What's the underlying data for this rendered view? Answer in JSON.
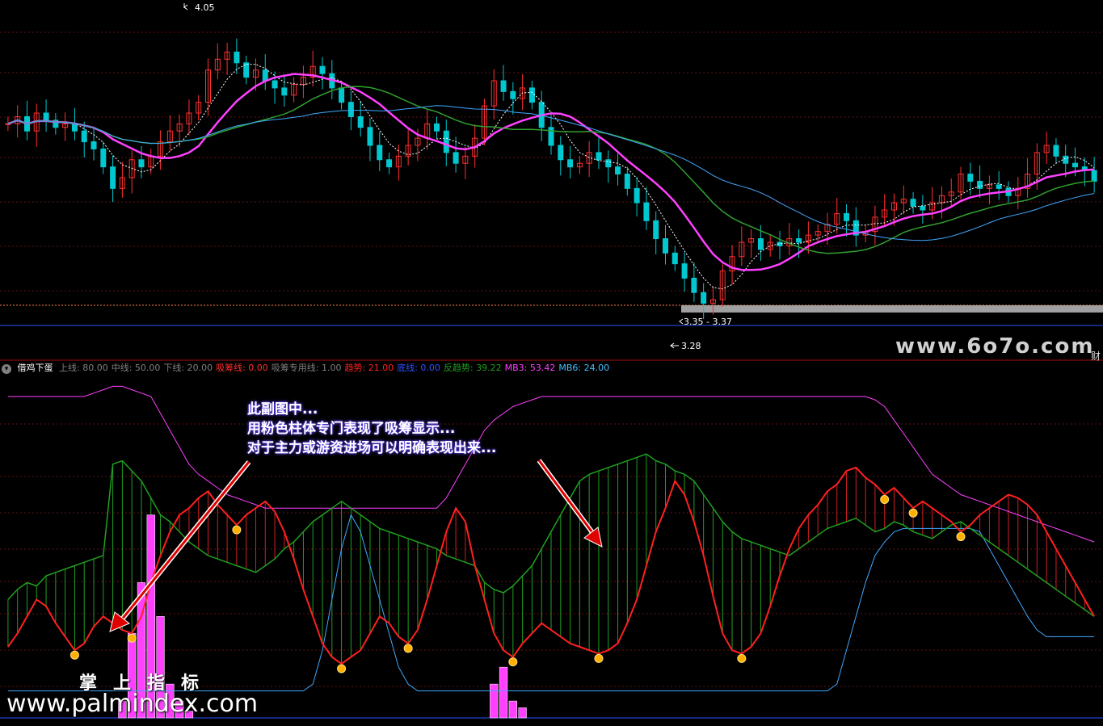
{
  "price_panel": {
    "high_label": "4.05",
    "low_label": "3.28",
    "range_label": "3.35 - 3.37",
    "side_tab": "财",
    "watermark": "www.6o7o.com"
  },
  "indicator_header": {
    "collapse_icon": "chevron-down-icon",
    "name": "借鸡下蛋",
    "items": [
      {
        "label": "上线:",
        "value": "80.00",
        "color": "#808080"
      },
      {
        "label": "中线:",
        "value": "50.00",
        "color": "#808080"
      },
      {
        "label": "下线:",
        "value": "20.00",
        "color": "#808080"
      },
      {
        "label": "吸筹线:",
        "value": "0.00",
        "color": "#ff3030"
      },
      {
        "label": "吸筹专用线:",
        "value": "1.00",
        "color": "#808080"
      },
      {
        "label": "趋势:",
        "value": "21.00",
        "color": "#ff2020"
      },
      {
        "label": "底线:",
        "value": "0.00",
        "color": "#3050ff"
      },
      {
        "label": "反趋势:",
        "value": "39.22",
        "color": "#20a020"
      },
      {
        "label": "MB3:",
        "value": "53.42",
        "color": "#ff40ff"
      },
      {
        "label": "MB6:",
        "value": "24.00",
        "color": "#40c0ff"
      }
    ]
  },
  "annotation": {
    "line1": "此副图中...",
    "line2": "用粉色柱体专门表现了吸筹显示...",
    "line3": "对于主力或游资进场可以明确表现出来..."
  },
  "watermarks": {
    "brand_cn": "掌上指标",
    "brand_url": "www.palmindex.com"
  },
  "colors": {
    "up": "#ff3030",
    "down": "#00c8d0",
    "ma_short": "#ff40ff",
    "ma_mid": "#30a030",
    "ma_long": "#40a8ff",
    "absorb_bar": "#ff40ff",
    "trend": "#ff2020",
    "counter_trend": "#20a020",
    "mb3": "#ff40ff",
    "mb6": "#40a8ff",
    "bottom": "#3050ff"
  },
  "chart_data": [
    {
      "type": "candlestick",
      "title": "",
      "annotations": [
        "4.05",
        "3.28",
        "3.35 - 3.37"
      ],
      "ylim": [
        3.2,
        4.1
      ],
      "closes": [
        3.8,
        3.82,
        3.78,
        3.83,
        3.81,
        3.79,
        3.8,
        3.78,
        3.75,
        3.73,
        3.68,
        3.62,
        3.65,
        3.7,
        3.68,
        3.71,
        3.75,
        3.78,
        3.8,
        3.83,
        3.86,
        3.95,
        3.98,
        4.0,
        3.97,
        3.93,
        3.95,
        3.92,
        3.9,
        3.88,
        3.91,
        3.93,
        3.96,
        3.94,
        3.9,
        3.86,
        3.82,
        3.79,
        3.74,
        3.7,
        3.68,
        3.71,
        3.74,
        3.76,
        3.8,
        3.78,
        3.72,
        3.69,
        3.71,
        3.76,
        3.85,
        3.92,
        3.89,
        3.87,
        3.9,
        3.86,
        3.79,
        3.74,
        3.7,
        3.68,
        3.69,
        3.72,
        3.7,
        3.68,
        3.66,
        3.62,
        3.58,
        3.53,
        3.48,
        3.44,
        3.41,
        3.37,
        3.33,
        3.3,
        3.31,
        3.39,
        3.43,
        3.47,
        3.48,
        3.45,
        3.47,
        3.46,
        3.48,
        3.47,
        3.49,
        3.5,
        3.52,
        3.55,
        3.53,
        3.49,
        3.5,
        3.54,
        3.56,
        3.58,
        3.59,
        3.57,
        3.56,
        3.58,
        3.6,
        3.61,
        3.66,
        3.64,
        3.62,
        3.63,
        3.62,
        3.6,
        3.62,
        3.66,
        3.72,
        3.74,
        3.71,
        3.69,
        3.68,
        3.67,
        3.64
      ]
    },
    {
      "type": "mixed",
      "title": "借鸡下蛋",
      "ylim": [
        0,
        100
      ],
      "series": [
        {
          "name": "吸筹线",
          "kind": "bar",
          "values": [
            0,
            0,
            0,
            0,
            0,
            0,
            0,
            0,
            0,
            0,
            0,
            0,
            5,
            25,
            40,
            60,
            30,
            10,
            5,
            2,
            0,
            0,
            0,
            0,
            0,
            0,
            0,
            0,
            0,
            0,
            0,
            0,
            0,
            0,
            0,
            0,
            0,
            0,
            0,
            0,
            0,
            0,
            0,
            0,
            0,
            0,
            0,
            0,
            0,
            0,
            0,
            10,
            15,
            5,
            3,
            0,
            0,
            0,
            0,
            0,
            0,
            0,
            0,
            0,
            0,
            0,
            0,
            0,
            0,
            0,
            0,
            0,
            0,
            0,
            0,
            0,
            0,
            0,
            0,
            0,
            0,
            0,
            0,
            0,
            0,
            0,
            0,
            0,
            0,
            0,
            0,
            0,
            0,
            0,
            0,
            0,
            0,
            0,
            0,
            0,
            0,
            0,
            0,
            0,
            0,
            0,
            0,
            0,
            0,
            0,
            0,
            0,
            0,
            0,
            0
          ]
        },
        {
          "name": "趋势",
          "kind": "line",
          "values": [
            21,
            25,
            30,
            35,
            33,
            28,
            24,
            20,
            22,
            27,
            30,
            28,
            26,
            25,
            30,
            40,
            48,
            55,
            60,
            62,
            65,
            67,
            63,
            60,
            57,
            60,
            62,
            64,
            61,
            55,
            47,
            38,
            30,
            22,
            18,
            16,
            18,
            20,
            25,
            30,
            28,
            24,
            22,
            26,
            35,
            45,
            55,
            62,
            58,
            45,
            35,
            25,
            20,
            18,
            22,
            25,
            28,
            26,
            24,
            22,
            21,
            20,
            19,
            20,
            22,
            28,
            35,
            45,
            55,
            62,
            70,
            66,
            58,
            48,
            36,
            25,
            20,
            19,
            21,
            25,
            33,
            42,
            50,
            56,
            60,
            63,
            67,
            69,
            73,
            74,
            71,
            69,
            66,
            68,
            65,
            62,
            64,
            62,
            60,
            58,
            55,
            57,
            60,
            62,
            64,
            66,
            65,
            63,
            60,
            55,
            50,
            45,
            40,
            35,
            30
          ]
        },
        {
          "name": "反趋势",
          "kind": "line",
          "values": [
            35,
            38,
            40,
            39,
            42,
            43,
            44,
            45,
            46,
            47,
            48,
            75,
            76,
            73,
            70,
            65,
            60,
            58,
            55,
            52,
            50,
            48,
            47,
            46,
            45,
            44,
            43,
            45,
            47,
            50,
            52,
            55,
            58,
            60,
            62,
            64,
            62,
            60,
            58,
            56,
            55,
            54,
            53,
            52,
            51,
            50,
            48,
            47,
            46,
            45,
            40,
            38,
            37,
            39,
            42,
            45,
            50,
            55,
            60,
            65,
            70,
            72,
            73,
            74,
            75,
            76,
            77,
            78,
            76,
            75,
            73,
            72,
            70,
            66,
            62,
            58,
            55,
            53,
            52,
            51,
            50,
            49,
            48,
            50,
            52,
            54,
            56,
            57,
            58,
            59,
            57,
            55,
            56,
            58,
            57,
            55,
            54,
            53,
            55,
            57,
            58,
            56,
            54,
            52,
            50,
            48,
            46,
            44,
            42,
            40,
            38,
            36,
            34,
            32,
            30
          ]
        },
        {
          "name": "MB3",
          "kind": "line",
          "values": [
            95,
            95,
            95,
            95,
            95,
            95,
            95,
            95,
            95,
            96,
            97,
            98,
            98,
            97,
            96,
            95,
            90,
            85,
            80,
            75,
            72,
            70,
            68,
            66,
            65,
            64,
            63,
            62,
            62,
            62,
            62,
            62,
            62,
            62,
            62,
            62,
            62,
            62,
            62,
            62,
            62,
            62,
            62,
            62,
            62,
            62,
            65,
            70,
            75,
            80,
            85,
            88,
            90,
            92,
            93,
            94,
            95,
            95,
            95,
            95,
            95,
            95,
            95,
            95,
            95,
            95,
            95,
            95,
            95,
            95,
            95,
            95,
            95,
            95,
            95,
            95,
            95,
            95,
            95,
            95,
            95,
            95,
            95,
            95,
            95,
            95,
            95,
            95,
            95,
            95,
            95,
            94,
            92,
            88,
            84,
            80,
            76,
            72,
            70,
            68,
            66,
            65,
            64,
            63,
            62,
            61,
            60,
            59,
            58,
            57,
            56,
            55,
            54,
            53,
            52
          ]
        },
        {
          "name": "MB6",
          "kind": "line",
          "values": [
            8,
            8,
            8,
            8,
            8,
            8,
            8,
            8,
            8,
            8,
            8,
            8,
            8,
            8,
            8,
            8,
            8,
            8,
            8,
            8,
            8,
            8,
            8,
            8,
            8,
            8,
            8,
            8,
            8,
            8,
            8,
            8,
            10,
            20,
            35,
            50,
            60,
            55,
            45,
            35,
            25,
            15,
            10,
            8,
            8,
            8,
            8,
            8,
            8,
            8,
            8,
            8,
            8,
            8,
            8,
            8,
            8,
            8,
            8,
            8,
            8,
            8,
            8,
            8,
            8,
            8,
            8,
            8,
            8,
            8,
            8,
            8,
            8,
            8,
            8,
            8,
            8,
            8,
            8,
            8,
            8,
            8,
            8,
            8,
            8,
            8,
            8,
            10,
            20,
            30,
            40,
            48,
            52,
            55,
            56,
            56,
            56,
            56,
            56,
            56,
            56,
            56,
            55,
            50,
            45,
            40,
            35,
            30,
            26,
            24,
            24,
            24,
            24,
            24,
            24
          ]
        }
      ]
    }
  ]
}
